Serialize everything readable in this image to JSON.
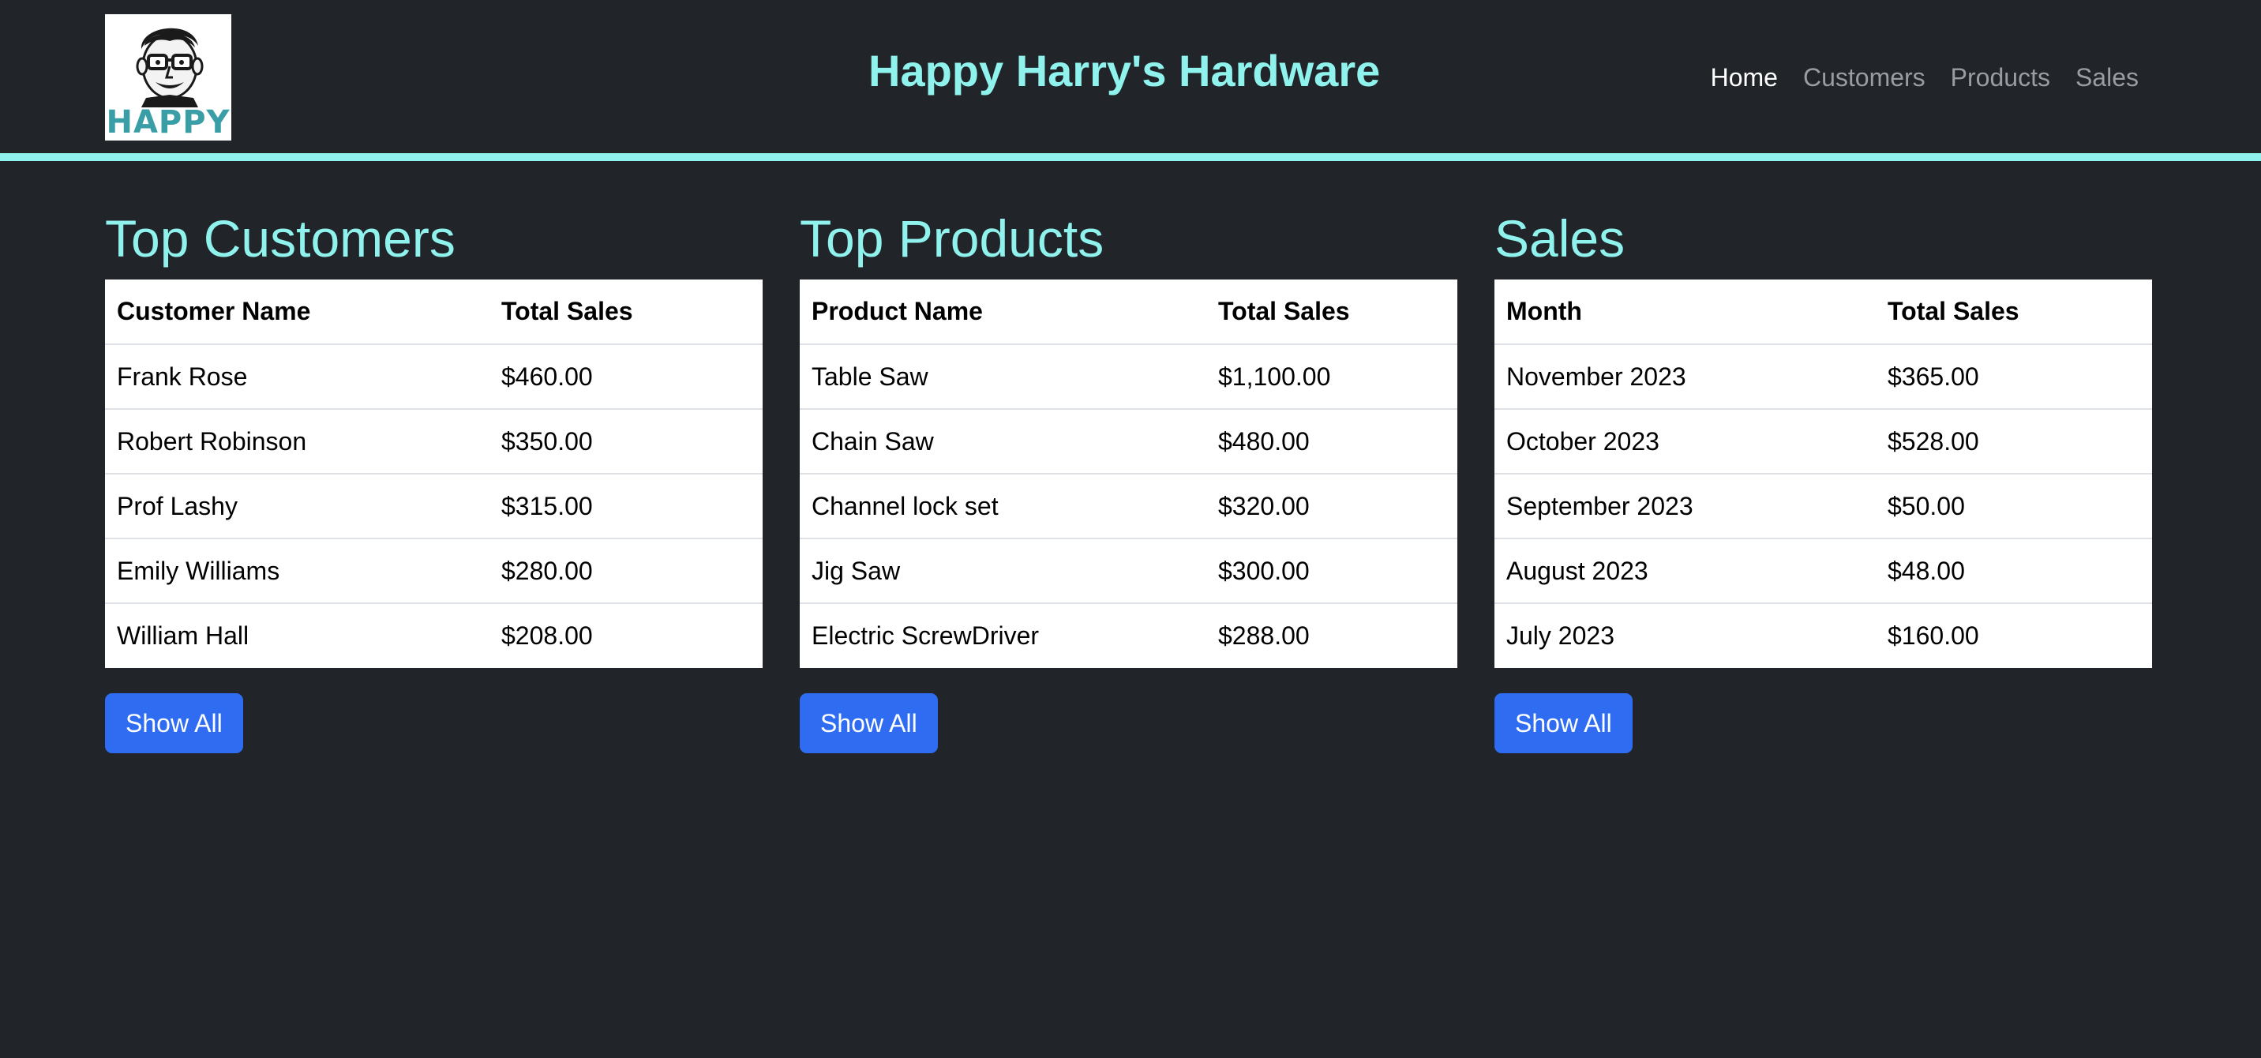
{
  "header": {
    "logo_text": "HAPPY",
    "title": "Happy Harry's Hardware",
    "nav": [
      {
        "label": "Home",
        "active": true
      },
      {
        "label": "Customers",
        "active": false
      },
      {
        "label": "Products",
        "active": false
      },
      {
        "label": "Sales",
        "active": false
      }
    ]
  },
  "panels": [
    {
      "title": "Top Customers",
      "columns": [
        "Customer Name",
        "Total Sales"
      ],
      "rows": [
        [
          "Frank Rose",
          "$460.00"
        ],
        [
          "Robert Robinson",
          "$350.00"
        ],
        [
          "Prof Lashy",
          "$315.00"
        ],
        [
          "Emily Williams",
          "$280.00"
        ],
        [
          "William Hall",
          "$208.00"
        ]
      ],
      "button_label": "Show All"
    },
    {
      "title": "Top Products",
      "columns": [
        "Product Name",
        "Total Sales"
      ],
      "rows": [
        [
          "Table Saw",
          "$1,100.00"
        ],
        [
          "Chain Saw",
          "$480.00"
        ],
        [
          "Channel lock set",
          "$320.00"
        ],
        [
          "Jig Saw",
          "$300.00"
        ],
        [
          "Electric ScrewDriver",
          "$288.00"
        ]
      ],
      "button_label": "Show All"
    },
    {
      "title": "Sales",
      "columns": [
        "Month",
        "Total Sales"
      ],
      "rows": [
        [
          "November 2023",
          "$365.00"
        ],
        [
          "October 2023",
          "$528.00"
        ],
        [
          "September 2023",
          "$50.00"
        ],
        [
          "August 2023",
          "$48.00"
        ],
        [
          "July 2023",
          "$160.00"
        ]
      ],
      "button_label": "Show All"
    }
  ],
  "colors": {
    "background": "#212529",
    "accent": "#8ff2ec",
    "button": "#2f6cf2",
    "logo_text": "#3a9ea6"
  },
  "icons": {
    "logo": "harry-face-logo"
  }
}
